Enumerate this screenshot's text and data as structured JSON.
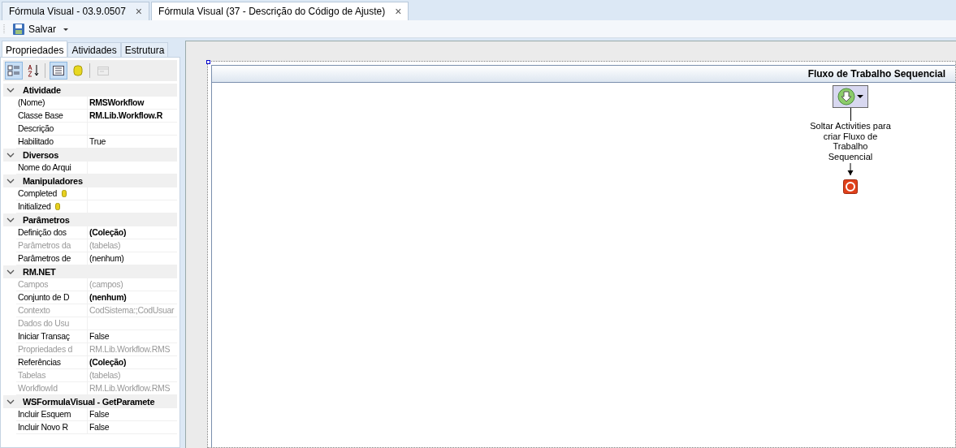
{
  "doc_tabs": [
    {
      "label": "Fórmula Visual - 03.9.0507",
      "close": "×",
      "selected": false
    },
    {
      "label": "Fórmula Visual (37 - Descrição do Código de Ajuste)",
      "close": "×",
      "selected": true
    }
  ],
  "toolbar": {
    "save": "Salvar"
  },
  "panel_tabs": [
    {
      "label": "Propriedades",
      "selected": true
    },
    {
      "label": "Atividades",
      "selected": false
    },
    {
      "label": "Estrutura",
      "selected": false
    }
  ],
  "grid_tools": [
    {
      "kind": "categorized",
      "selected": true,
      "disabled": false
    },
    {
      "kind": "alphabetical",
      "selected": false,
      "disabled": false
    },
    {
      "kind": "properties",
      "selected": true,
      "disabled": false
    },
    {
      "kind": "events",
      "selected": false,
      "disabled": false
    },
    {
      "kind": "pages",
      "selected": false,
      "disabled": true
    }
  ],
  "categories": [
    {
      "name": "Atividade",
      "expanded": true,
      "items": [
        {
          "name": "(Nome)",
          "value": "RMSWorkflow",
          "bold": true,
          "disabled": false
        },
        {
          "name": "Classe Base",
          "value": "RM.Lib.Workflow.R",
          "bold": true,
          "disabled": false
        },
        {
          "name": "Descrição",
          "disabled": false
        },
        {
          "name": "Habilitado",
          "value": "True",
          "bold": false,
          "disabled": false
        }
      ]
    },
    {
      "name": "Diversos",
      "expanded": true,
      "items": [
        {
          "name": "Nome do Arqui",
          "disabled": false
        }
      ]
    },
    {
      "name": "Manipuladores",
      "expanded": true,
      "items": [
        {
          "name": "Completed",
          "kind": "event",
          "disabled": false
        },
        {
          "name": "Initialized",
          "kind": "event",
          "disabled": false
        }
      ]
    },
    {
      "name": "Parâmetros",
      "expanded": true,
      "items": [
        {
          "name": "Definição dos",
          "value": "(Coleção)",
          "bold": true,
          "disabled": false
        },
        {
          "name": "Parâmetros da",
          "value": "(tabelas)",
          "bold": false,
          "disabled": true
        },
        {
          "name": "Parâmetros de",
          "value": "(nenhum)",
          "bold": false,
          "disabled": false
        }
      ]
    },
    {
      "name": "RM.NET",
      "expanded": true,
      "items": [
        {
          "name": "Campos",
          "value": "(campos)",
          "bold": false,
          "disabled": true
        },
        {
          "name": "Conjunto de D",
          "value": "(nenhum)",
          "bold": true,
          "disabled": false
        },
        {
          "name": "Contexto",
          "value": "CodSistema:;CodUsuar",
          "bold": false,
          "disabled": true
        },
        {
          "name": "Dados do Usu",
          "disabled": true
        },
        {
          "name": "Iniciar Transaç",
          "value": "False",
          "bold": false,
          "disabled": false
        },
        {
          "name": "Propriedades d",
          "value": "RM.Lib.Workflow.RMS",
          "bold": false,
          "disabled": true
        },
        {
          "name": "Referências",
          "value": "(Coleção)",
          "bold": true,
          "disabled": false
        },
        {
          "name": "Tabelas",
          "value": "(tabelas)",
          "bold": false,
          "disabled": true
        },
        {
          "name": "WorkflowId",
          "value": "RM.Lib.Workflow.RMS",
          "bold": false,
          "disabled": true
        }
      ]
    },
    {
      "name": "WSFormulaVisual - GetParamete",
      "expanded": true,
      "items": [
        {
          "name": "Incluir Esquem",
          "value": "False",
          "bold": false,
          "disabled": false
        },
        {
          "name": "Incluir Novo R",
          "value": "False",
          "bold": false,
          "disabled": false
        }
      ]
    }
  ],
  "designer": {
    "title": "Fluxo de Trabalho Sequencial",
    "hint": "Soltar Activities para criar Fluxo de Trabalho Sequencial"
  }
}
